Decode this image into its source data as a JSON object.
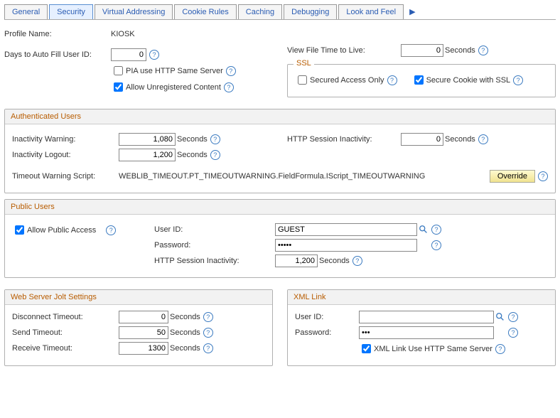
{
  "tabs": [
    "General",
    "Security",
    "Virtual Addressing",
    "Cookie Rules",
    "Caching",
    "Debugging",
    "Look and Feel"
  ],
  "activeTab": 1,
  "profile": {
    "label": "Profile Name:",
    "value": "KIOSK"
  },
  "daysAutoFill": {
    "label": "Days to Auto Fill User ID:",
    "value": "0"
  },
  "piaSameServer": {
    "label": "PIA use HTTP Same Server",
    "checked": false
  },
  "allowUnreg": {
    "label": "Allow Unregistered Content",
    "checked": true
  },
  "viewFileTTL": {
    "label": "View File Time to Live:",
    "value": "0",
    "unit": "Seconds"
  },
  "ssl": {
    "title": "SSL",
    "securedOnly": {
      "label": "Secured Access Only",
      "checked": false
    },
    "secureCookie": {
      "label": "Secure Cookie with SSL",
      "checked": true
    }
  },
  "auth": {
    "title": "Authenticated Users",
    "inactWarn": {
      "label": "Inactivity Warning:",
      "value": "1,080",
      "unit": "Seconds"
    },
    "inactLogout": {
      "label": "Inactivity Logout:",
      "value": "1,200",
      "unit": "Seconds"
    },
    "httpInact": {
      "label": "HTTP Session Inactivity:",
      "value": "0",
      "unit": "Seconds"
    },
    "timeoutScript": {
      "label": "Timeout Warning Script:",
      "value": "WEBLIB_TIMEOUT.PT_TIMEOUTWARNING.FieldFormula.IScript_TIMEOUTWARNING"
    },
    "override": "Override"
  },
  "pub": {
    "title": "Public Users",
    "allow": {
      "label": "Allow Public Access",
      "checked": true
    },
    "userId": {
      "label": "User ID:",
      "value": "GUEST"
    },
    "password": {
      "label": "Password:",
      "value": "•••••"
    },
    "httpInact": {
      "label": "HTTP Session Inactivity:",
      "value": "1,200",
      "unit": "Seconds"
    }
  },
  "jolt": {
    "title": "Web Server Jolt Settings",
    "disconnect": {
      "label": "Disconnect Timeout:",
      "value": "0",
      "unit": "Seconds"
    },
    "send": {
      "label": "Send Timeout:",
      "value": "50",
      "unit": "Seconds"
    },
    "receive": {
      "label": "Receive Timeout:",
      "value": "1300",
      "unit": "Seconds"
    }
  },
  "xml": {
    "title": "XML Link",
    "userId": {
      "label": "User ID:",
      "value": ""
    },
    "password": {
      "label": "Password:",
      "value": "•••"
    },
    "sameServer": {
      "label": "XML Link Use HTTP Same Server",
      "checked": true
    }
  }
}
